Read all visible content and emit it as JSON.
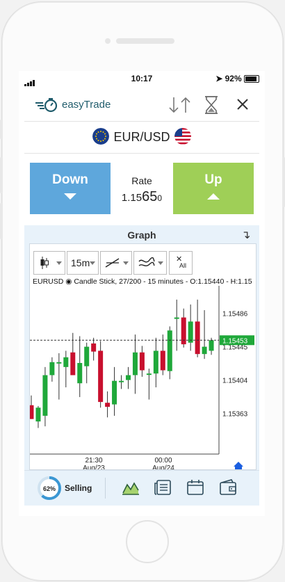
{
  "status": {
    "time": "10:17",
    "battery": "92%"
  },
  "header": {
    "brand": "easyTrade"
  },
  "pair": {
    "name": "EUR/USD"
  },
  "trade": {
    "down_label": "Down",
    "up_label": "Up",
    "rate_label": "Rate",
    "rate_prefix": "1.15",
    "rate_big": "65",
    "rate_suffix": "0"
  },
  "graph": {
    "title": "Graph",
    "timeframe": "15m",
    "all_label": "All",
    "info": "EURUSD  ◉ Candle Stick, 27/200 - 15 minutes - O:1.15440 - H:1.15"
  },
  "chart_data": {
    "type": "candlestick",
    "symbol": "EURUSD",
    "interval": "15 minutes",
    "y_ticks": [
      "1.15486",
      "1.15445",
      "1.15404",
      "1.15363"
    ],
    "y_tick_values": [
      1.15486,
      1.15445,
      1.15404,
      1.15363
    ],
    "current_price": "1.15453",
    "current_value": 1.15453,
    "x_labels": [
      {
        "time": "21:30",
        "date": "Aug/23"
      },
      {
        "time": "00:00",
        "date": "Aug/24"
      }
    ],
    "ylim": [
      1.1533,
      1.1552
    ],
    "colors": {
      "up": "#1fa83a",
      "down": "#c8102e"
    },
    "candles": [
      {
        "o": 1.15373,
        "h": 1.15385,
        "l": 1.15356,
        "c": 1.15356
      },
      {
        "o": 1.15353,
        "h": 1.15372,
        "l": 1.15345,
        "c": 1.1537
      },
      {
        "o": 1.1536,
        "h": 1.1542,
        "l": 1.15347,
        "c": 1.1541
      },
      {
        "o": 1.1541,
        "h": 1.15432,
        "l": 1.15402,
        "c": 1.15426
      },
      {
        "o": 1.15426,
        "h": 1.15437,
        "l": 1.1538,
        "c": 1.15426
      },
      {
        "o": 1.1542,
        "h": 1.1544,
        "l": 1.15395,
        "c": 1.15432
      },
      {
        "o": 1.15438,
        "h": 1.15462,
        "l": 1.1541,
        "c": 1.1541
      },
      {
        "o": 1.154,
        "h": 1.15458,
        "l": 1.15383,
        "c": 1.15425
      },
      {
        "o": 1.15421,
        "h": 1.1545,
        "l": 1.154,
        "c": 1.15445
      },
      {
        "o": 1.15449,
        "h": 1.15456,
        "l": 1.15428,
        "c": 1.15439
      },
      {
        "o": 1.1544,
        "h": 1.15452,
        "l": 1.1537,
        "c": 1.15377
      },
      {
        "o": 1.15376,
        "h": 1.1539,
        "l": 1.15358,
        "c": 1.15371
      },
      {
        "o": 1.15374,
        "h": 1.1542,
        "l": 1.1536,
        "c": 1.15403
      },
      {
        "o": 1.15403,
        "h": 1.1541,
        "l": 1.15393,
        "c": 1.15403
      },
      {
        "o": 1.15404,
        "h": 1.1542,
        "l": 1.15393,
        "c": 1.1541
      },
      {
        "o": 1.1541,
        "h": 1.1546,
        "l": 1.15387,
        "c": 1.15438
      },
      {
        "o": 1.15438,
        "h": 1.15446,
        "l": 1.15408,
        "c": 1.15416
      },
      {
        "o": 1.15412,
        "h": 1.15418,
        "l": 1.1538,
        "c": 1.15412
      },
      {
        "o": 1.15412,
        "h": 1.15456,
        "l": 1.15395,
        "c": 1.1544
      },
      {
        "o": 1.1544,
        "h": 1.1546,
        "l": 1.1541,
        "c": 1.15416
      },
      {
        "o": 1.15415,
        "h": 1.1547,
        "l": 1.15405,
        "c": 1.15465
      },
      {
        "o": 1.15481,
        "h": 1.15503,
        "l": 1.1544,
        "c": 1.15481
      },
      {
        "o": 1.15481,
        "h": 1.15492,
        "l": 1.15444,
        "c": 1.15448
      },
      {
        "o": 1.1545,
        "h": 1.15497,
        "l": 1.1544,
        "c": 1.15476
      },
      {
        "o": 1.15476,
        "h": 1.15503,
        "l": 1.15432,
        "c": 1.15436
      },
      {
        "o": 1.15436,
        "h": 1.1549,
        "l": 1.1543,
        "c": 1.15445
      },
      {
        "o": 1.1544,
        "h": 1.15456,
        "l": 1.15435,
        "c": 1.15453
      }
    ]
  },
  "tabbar": {
    "progress_label": "62%",
    "progress": 0.62,
    "selling_label": "Selling"
  }
}
